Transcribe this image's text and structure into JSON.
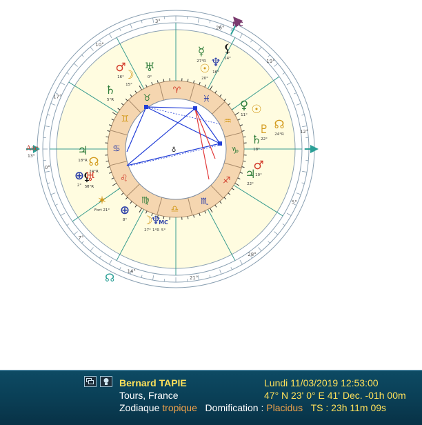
{
  "chart": {
    "ascendant_label": "Asc",
    "ascendant_degree": "13°",
    "mc_label": "MC",
    "signs": [
      "♈",
      "♉",
      "♊",
      "♋",
      "♌",
      "♍",
      "♎",
      "♏",
      "♐",
      "♑",
      "♒",
      "♓"
    ],
    "colors": {
      "outer_fill": "#fffce0",
      "sign_ring": "#f5d6b0",
      "house_line": "#3a9c8f",
      "fire": "#d23a2a",
      "earth": "#2f7d3a",
      "air": "#d39a1c",
      "water": "#2c3fa8",
      "aspect_blue": "#2440d8",
      "aspect_red": "#e23a3a",
      "arrow": "#2a9f96"
    },
    "planets": [
      {
        "name": "mars",
        "glyph": "♂",
        "degree": "16°",
        "color": "#d23a2a"
      },
      {
        "name": "moon",
        "glyph": "☽",
        "degree": "15°",
        "color": "#d39a1c"
      },
      {
        "name": "uranus",
        "glyph": "♅",
        "degree": "0°",
        "color": "#2f7d3a"
      },
      {
        "name": "mercury",
        "glyph": "☿",
        "degree": "27°R",
        "color": "#2f7d3a"
      },
      {
        "name": "sun",
        "glyph": "☉",
        "degree": "20°",
        "color": "#d39a1c"
      },
      {
        "name": "neptune",
        "glyph": "♆",
        "degree": "16°",
        "color": "#2c3fa8"
      },
      {
        "name": "lilith",
        "glyph": "⚸",
        "degree": "14°",
        "color": "#111111"
      },
      {
        "name": "saturn",
        "glyph": "♄",
        "degree": "5°R",
        "color": "#2f7d3a"
      },
      {
        "name": "venus",
        "glyph": "♀",
        "degree": "11°",
        "color": "#2f7d3a"
      },
      {
        "name": "sun2",
        "glyph": "☉",
        "degree": "",
        "color": "#d39a1c"
      },
      {
        "name": "pluto",
        "glyph": "♇",
        "degree": "22°",
        "color": "#d39a1c"
      },
      {
        "name": "node",
        "glyph": "☊",
        "degree": "24°R",
        "color": "#d39a1c"
      },
      {
        "name": "saturn2",
        "glyph": "♄",
        "degree": "18°",
        "color": "#2f7d3a"
      },
      {
        "name": "jupiter",
        "glyph": "♃",
        "degree": "22°",
        "color": "#2f7d3a"
      },
      {
        "name": "mars2",
        "glyph": "♂",
        "degree": "10°",
        "color": "#d23a2a"
      },
      {
        "name": "jupiter2",
        "glyph": "♃",
        "degree": "18°R",
        "color": "#2f7d3a"
      },
      {
        "name": "node2",
        "glyph": "☊",
        "degree": "24°R",
        "color": "#d39a1c"
      },
      {
        "name": "earth",
        "glyph": "⊕",
        "degree": "2°",
        "color": "#2c3fa8"
      },
      {
        "name": "lilith2",
        "glyph": "⚸",
        "degree": "5°",
        "color": "#111111"
      },
      {
        "name": "uranus2",
        "glyph": "♅",
        "degree": "6°R",
        "color": "#d23a2a"
      },
      {
        "name": "fortune",
        "glyph": "✶",
        "degree": "Fort 21°",
        "color": "#d39a1c"
      },
      {
        "name": "vertex",
        "glyph": "⊕",
        "degree": "8°",
        "color": "#2c3fa8"
      },
      {
        "name": "moon2",
        "glyph": "☽",
        "degree": "27°",
        "color": "#d39a1c"
      },
      {
        "name": "neptune2",
        "glyph": "♆",
        "degree": "1°R",
        "color": "#2c3fa8"
      },
      {
        "name": "mc2",
        "glyph": "MC",
        "degree": "5°",
        "color": "#2c3fa8"
      }
    ]
  },
  "info": {
    "name": "Bernard TAPIE",
    "place": "Tours, France",
    "zodiac_label": "Zodiaque",
    "zodiac_value": "tropique",
    "domification_label": "Domification :",
    "domification_value": "Placidus",
    "ts": "TS : 23h 11m 09s",
    "datetime": "Lundi 11/03/2019 12:53:00",
    "coords": "47° N 23' 0° E 41' Dec. -01h 00m"
  }
}
